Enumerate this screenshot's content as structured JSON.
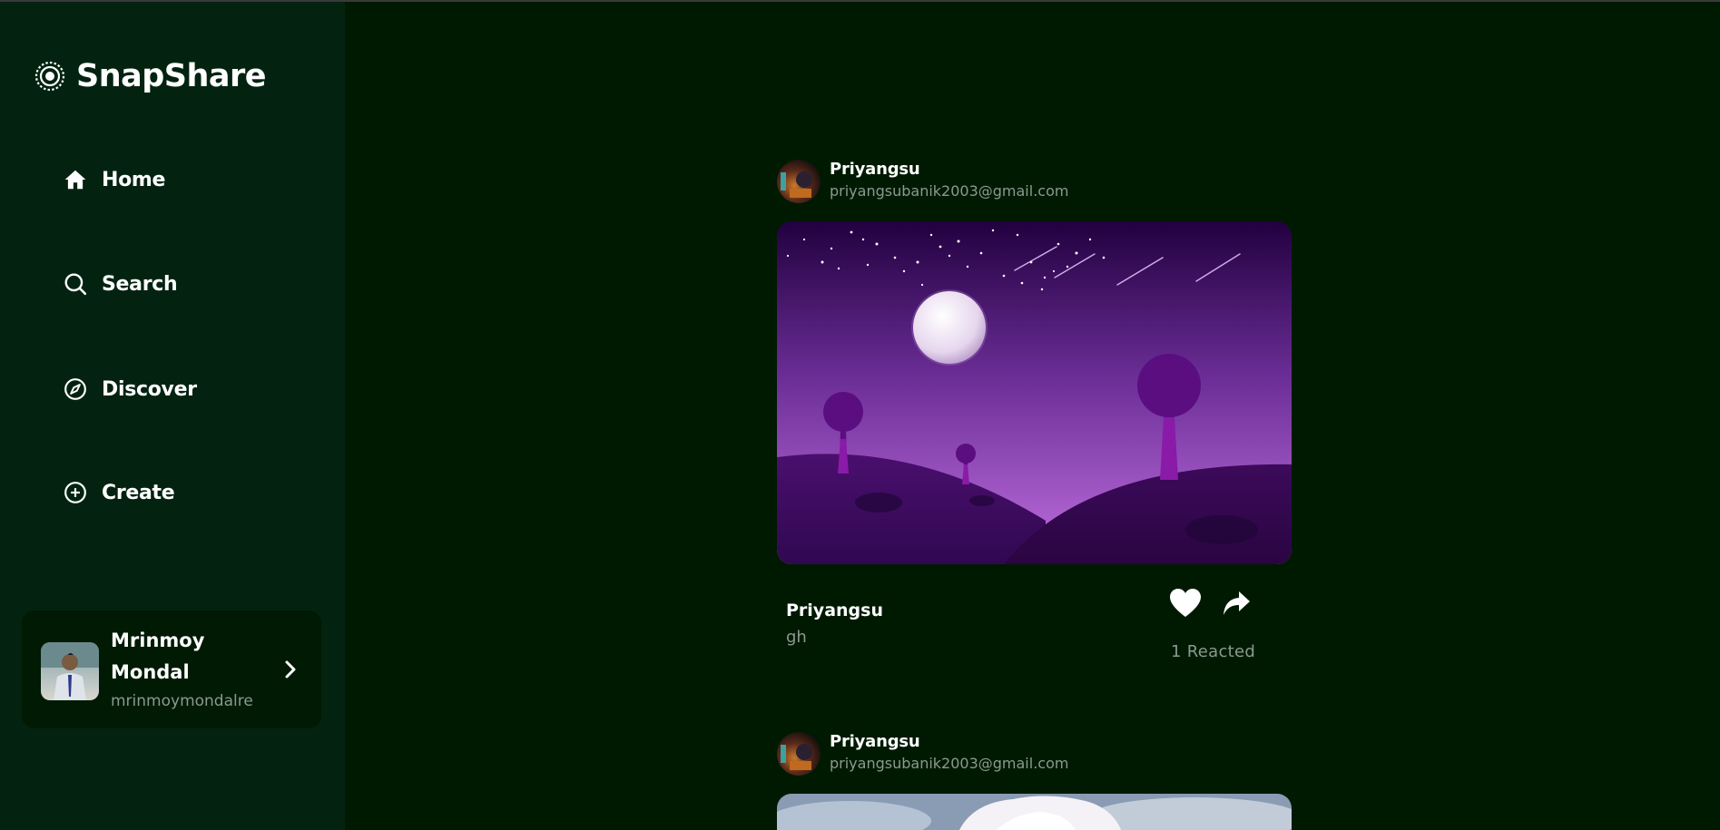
{
  "app": {
    "name": "SnapShare"
  },
  "nav": {
    "items": [
      {
        "label": "Home",
        "icon": "home-icon"
      },
      {
        "label": "Search",
        "icon": "search-icon"
      },
      {
        "label": "Discover",
        "icon": "compass-icon"
      },
      {
        "label": "Create",
        "icon": "plus-circle-icon"
      }
    ]
  },
  "profile": {
    "name": "Mrinmoy Mondal",
    "handle": "mrinmoymondalre"
  },
  "posts": [
    {
      "user": "Priyangsu",
      "email": "priyangsubanik2003@gmail.com",
      "caption_user": "Priyangsu",
      "caption": "gh",
      "reactions": "1 Reacted"
    },
    {
      "user": "Priyangsu",
      "email": "priyangsubanik2003@gmail.com"
    }
  ],
  "colors": {
    "background": "#001a02",
    "sidebar": "#032310",
    "profile_card": "#001a03",
    "muted_text": "#8a9a90"
  }
}
